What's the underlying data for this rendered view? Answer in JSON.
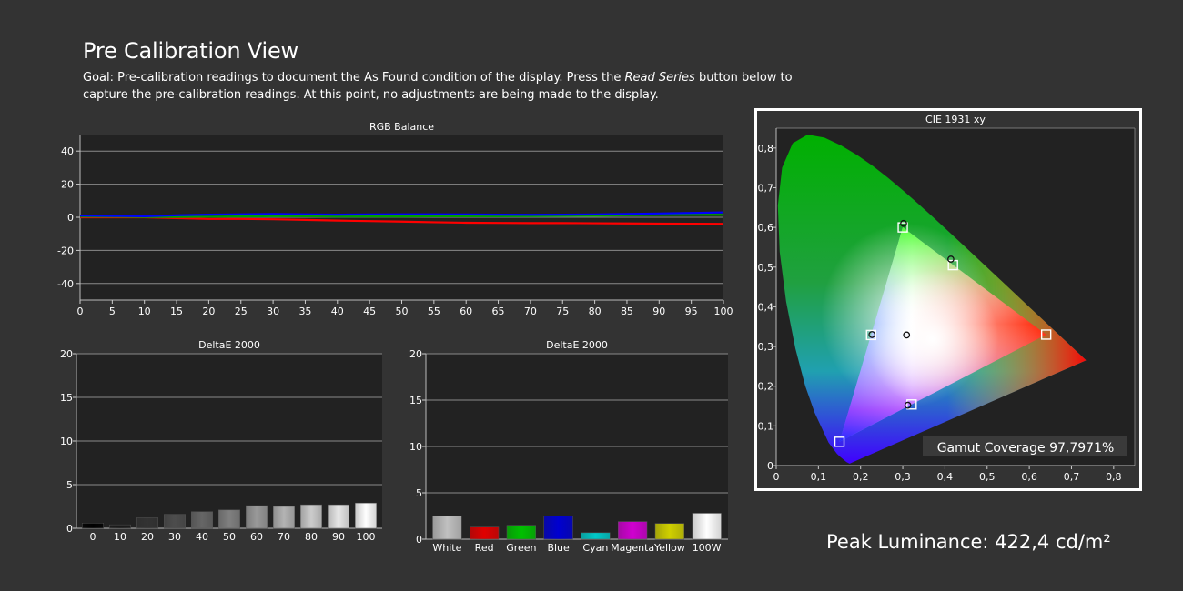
{
  "header": {
    "title": "Pre Calibration View",
    "goal_prefix": "Goal: Pre-calibration readings to document the As Found condition of the display. Press the ",
    "goal_emphasis": "Read Series",
    "goal_suffix": " button below to capture the pre-calibration readings. At this point, no adjustments are being made to the display."
  },
  "peak_luminance": "Peak Luminance: 422,4 cd/m²",
  "colors": {
    "background": "#333333",
    "plot_bg": "#222222",
    "red": "#ff0000",
    "green": "#00a000",
    "blue": "#0000ff"
  },
  "chart_data": [
    {
      "id": "rgb",
      "type": "line",
      "title": "RGB Balance",
      "x": [
        0,
        5,
        10,
        15,
        20,
        25,
        30,
        35,
        40,
        45,
        50,
        55,
        60,
        65,
        70,
        75,
        80,
        85,
        90,
        95,
        100
      ],
      "xticks": [
        "0",
        "5",
        "10",
        "15",
        "20",
        "25",
        "30",
        "35",
        "40",
        "45",
        "50",
        "55",
        "60",
        "65",
        "70",
        "75",
        "80",
        "85",
        "90",
        "95",
        "100"
      ],
      "ylim": [
        -50,
        50
      ],
      "yticks": [
        "40",
        "20",
        "0",
        "-20",
        "-40"
      ],
      "ytick_values": [
        40,
        20,
        0,
        -20,
        -40
      ],
      "grid": true,
      "series": [
        {
          "color": "#ff0000",
          "values": [
            0,
            0,
            0,
            -0.5,
            -1,
            -1,
            -1.2,
            -1.6,
            -2,
            -2.3,
            -2.6,
            -3,
            -3.3,
            -3.4,
            -3.5,
            -3.5,
            -3.6,
            -3.7,
            -3.8,
            -3.9,
            -4
          ]
        },
        {
          "color": "#00a000",
          "values": [
            0.5,
            0.4,
            0.2,
            0.2,
            0.3,
            0.5,
            0.7,
            0.6,
            0.5,
            0.5,
            0.5,
            0.6,
            0.6,
            0.6,
            0.7,
            0.8,
            0.9,
            1.2,
            1.4,
            1.5,
            1.5
          ]
        },
        {
          "color": "#0000ff",
          "values": [
            1,
            0.8,
            0.6,
            1.2,
            1.6,
            1.8,
            2,
            1.8,
            1.6,
            1.7,
            1.8,
            1.8,
            1.7,
            1.6,
            1.5,
            1.6,
            1.7,
            2,
            2.3,
            2.6,
            3
          ]
        }
      ]
    },
    {
      "id": "de_gray",
      "type": "bar",
      "title": "DeltaE 2000",
      "categories": [
        "0",
        "10",
        "20",
        "30",
        "40",
        "50",
        "60",
        "70",
        "80",
        "90",
        "100"
      ],
      "values": [
        0.6,
        0.4,
        1.2,
        1.6,
        1.9,
        2.1,
        2.6,
        2.5,
        2.7,
        2.7,
        2.9
      ],
      "bar_colors": [
        "#000000",
        "#1a1a1a",
        "#333333",
        "#4d4d4d",
        "#666666",
        "#808080",
        "#999999",
        "#b3b3b3",
        "#cccccc",
        "#e6e6e6",
        "#ffffff"
      ],
      "ylim": [
        0,
        20
      ],
      "yticks": [
        "20",
        "15",
        "10",
        "5",
        "0"
      ],
      "ytick_values": [
        20,
        15,
        10,
        5,
        0
      ],
      "grid": true
    },
    {
      "id": "de_color",
      "type": "bar",
      "title": "DeltaE 2000",
      "categories": [
        "White",
        "Red",
        "Green",
        "Blue",
        "Cyan",
        "Magenta",
        "Yellow",
        "100W"
      ],
      "values": [
        2.5,
        1.3,
        1.5,
        2.5,
        0.7,
        1.9,
        1.7,
        2.8
      ],
      "bar_colors": [
        "#c0c0c0",
        "#e00000",
        "#00c000",
        "#0000d0",
        "#00c8c8",
        "#d000d0",
        "#d0d000",
        "#ffffff"
      ],
      "ylim": [
        0,
        20
      ],
      "yticks": [
        "20",
        "15",
        "10",
        "5",
        "0"
      ],
      "ytick_values": [
        20,
        15,
        10,
        5,
        0
      ],
      "grid": true
    },
    {
      "id": "cie",
      "type": "scatter",
      "title": "CIE 1931 xy",
      "xlim": [
        0,
        0.85
      ],
      "ylim": [
        0,
        0.85
      ],
      "xticks": [
        "0",
        "0,1",
        "0,2",
        "0,3",
        "0,4",
        "0,5",
        "0,6",
        "0,7",
        "0,8"
      ],
      "yticks": [
        "0",
        "0,1",
        "0,2",
        "0,3",
        "0,4",
        "0,5",
        "0,6",
        "0,7",
        "0,8"
      ],
      "tick_values": [
        0,
        0.1,
        0.2,
        0.3,
        0.4,
        0.5,
        0.6,
        0.7,
        0.8
      ],
      "gamut_triangle": [
        [
          0.64,
          0.33
        ],
        [
          0.3,
          0.6
        ],
        [
          0.15,
          0.06
        ]
      ],
      "targets": [
        {
          "name": "Red",
          "x": 0.64,
          "y": 0.33
        },
        {
          "name": "Green",
          "x": 0.3,
          "y": 0.6
        },
        {
          "name": "Blue",
          "x": 0.15,
          "y": 0.06
        },
        {
          "name": "Cyan",
          "x": 0.225,
          "y": 0.329
        },
        {
          "name": "Magenta",
          "x": 0.321,
          "y": 0.154
        },
        {
          "name": "Yellow",
          "x": 0.419,
          "y": 0.505
        },
        {
          "name": "White",
          "x": 0.3127,
          "y": 0.329
        }
      ],
      "measured": [
        {
          "name": "Green",
          "x": 0.302,
          "y": 0.61
        },
        {
          "name": "Yellow",
          "x": 0.414,
          "y": 0.52
        },
        {
          "name": "Cyan",
          "x": 0.227,
          "y": 0.33
        },
        {
          "name": "White",
          "x": 0.309,
          "y": 0.329
        },
        {
          "name": "Magenta",
          "x": 0.312,
          "y": 0.152
        }
      ],
      "annotation": "Gamut Coverage 97,7971%"
    }
  ]
}
